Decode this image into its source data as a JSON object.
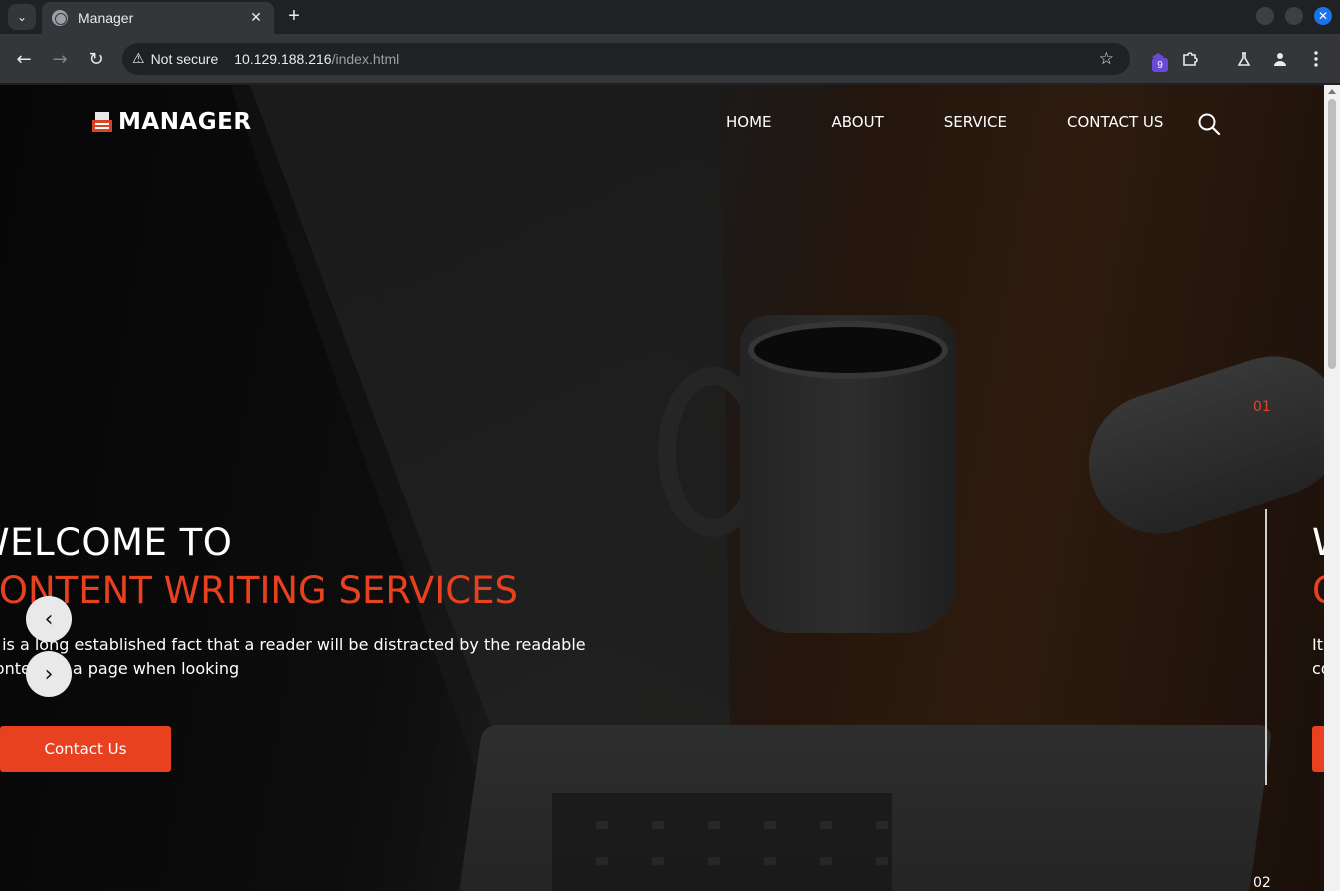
{
  "browser": {
    "tab_title": "Manager",
    "tab_close": "✕",
    "new_tab": "+",
    "security_label": "Not secure",
    "url_host": "10.129.188.216",
    "url_path": "/index.html",
    "extension_badge_count": "9"
  },
  "header": {
    "logo_text": "MANAGER",
    "nav": {
      "home": "HOME",
      "about": "ABOUT",
      "service": "SERVICE",
      "contact": "CONTACT US"
    }
  },
  "slider": {
    "title_line1": "WELCOME TO",
    "title_line2": "CONTENT WRITING SERVICES",
    "text_line1": "It is a long established fact that a reader will be distracted by the readable",
    "text_line2": "content of a page when looking",
    "cta_label": "Contact Us",
    "current_slide": "01",
    "next_slide": "02",
    "prev_arrow": "‹",
    "next_arrow": "›",
    "peek_title_line1": "W",
    "peek_title_line2": "C",
    "peek_text_line1": "It",
    "peek_text_line2": "co"
  },
  "colors": {
    "accent": "#e8411f",
    "browser_frame": "#202124",
    "toolbar": "#35363a"
  },
  "icons": [
    "tab-search-chevron-icon",
    "globe-icon",
    "close-icon",
    "plus-icon",
    "back-icon",
    "forward-icon",
    "reload-icon",
    "warning-icon",
    "star-icon",
    "extension-icon",
    "puzzle-icon",
    "labs-flask-icon",
    "profile-icon",
    "menu-kebab-icon",
    "printer-logo-icon",
    "search-icon",
    "chevron-left-icon",
    "chevron-right-icon"
  ]
}
